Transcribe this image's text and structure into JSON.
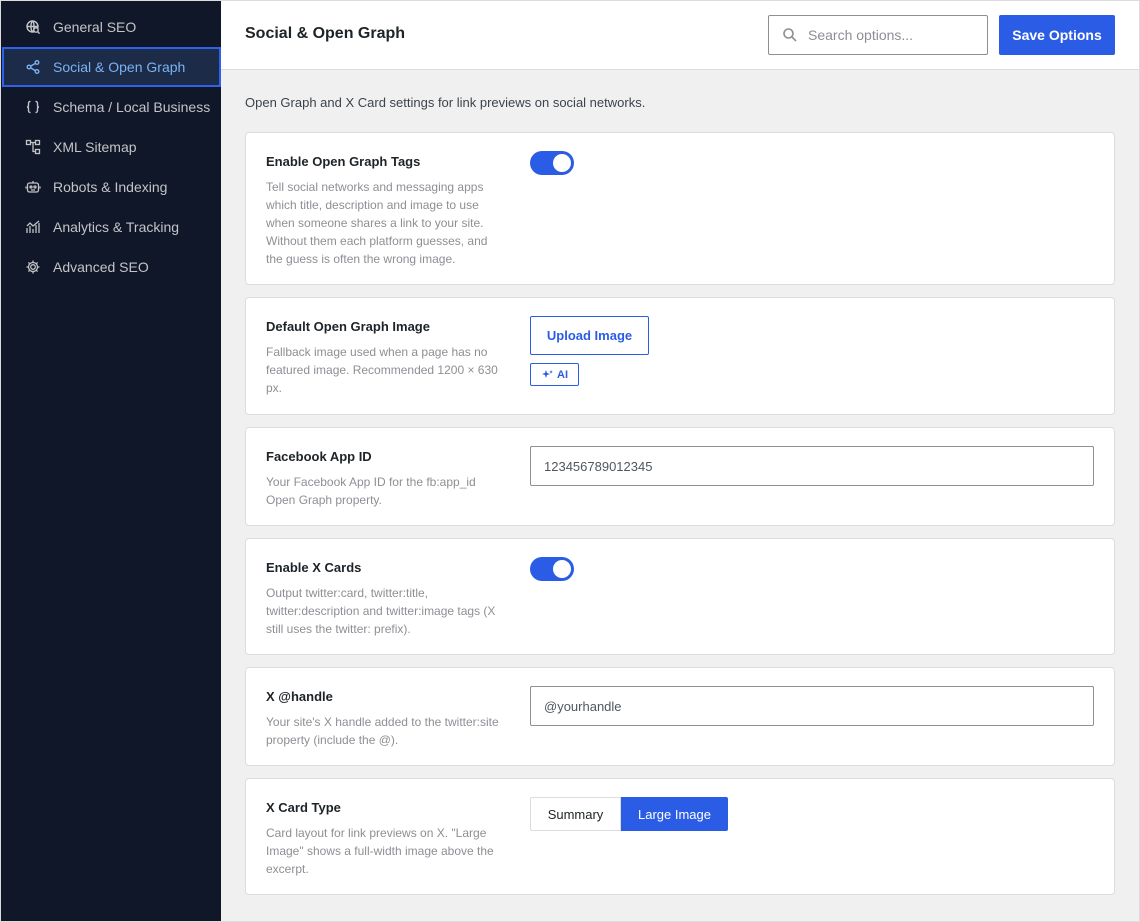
{
  "sidebar": {
    "items": [
      {
        "label": "General SEO",
        "icon": "globe-search-icon"
      },
      {
        "label": "Social & Open Graph",
        "icon": "share-icon",
        "active": true
      },
      {
        "label": "Schema / Local Business",
        "icon": "braces-icon"
      },
      {
        "label": "XML Sitemap",
        "icon": "sitemap-icon"
      },
      {
        "label": "Robots & Indexing",
        "icon": "robot-icon"
      },
      {
        "label": "Analytics & Tracking",
        "icon": "chart-icon"
      },
      {
        "label": "Advanced SEO",
        "icon": "gear-icon"
      }
    ]
  },
  "header": {
    "title": "Social & Open Graph",
    "search_placeholder": "Search options...",
    "save_label": "Save Options"
  },
  "intro": "Open Graph and X Card settings for link previews on social networks.",
  "settings": {
    "og_tags": {
      "title": "Enable Open Graph Tags",
      "desc": "Tell social networks and messaging apps which title, description and image to use when someone shares a link to your site. Without them each platform guesses, and the guess is often the wrong image.",
      "enabled": true
    },
    "og_image": {
      "title": "Default Open Graph Image",
      "desc": "Fallback image used when a page has no featured image. Recommended 1200 × 630 px.",
      "upload_label": "Upload Image",
      "ai_label": "AI"
    },
    "fb_app_id": {
      "title": "Facebook App ID",
      "desc": "Your Facebook App ID for the fb:app_id Open Graph property.",
      "value": "123456789012345"
    },
    "x_cards": {
      "title": "Enable X Cards",
      "desc": "Output twitter:card, twitter:title, twitter:description and twitter:image tags (X still uses the twitter: prefix).",
      "enabled": true
    },
    "x_handle": {
      "title": "X @handle",
      "desc": "Your site's X handle added to the twitter:site property (include the @).",
      "placeholder": "@yourhandle"
    },
    "x_card_type": {
      "title": "X Card Type",
      "desc": "Card layout for link previews on X. \"Large Image\" shows a full-width image above the excerpt.",
      "options": [
        "Summary",
        "Large Image"
      ],
      "selected": "Large Image"
    }
  },
  "colors": {
    "accent": "#2b5ce6",
    "sidebar_bg": "#101728",
    "sidebar_active_text": "#7ab2f4"
  }
}
